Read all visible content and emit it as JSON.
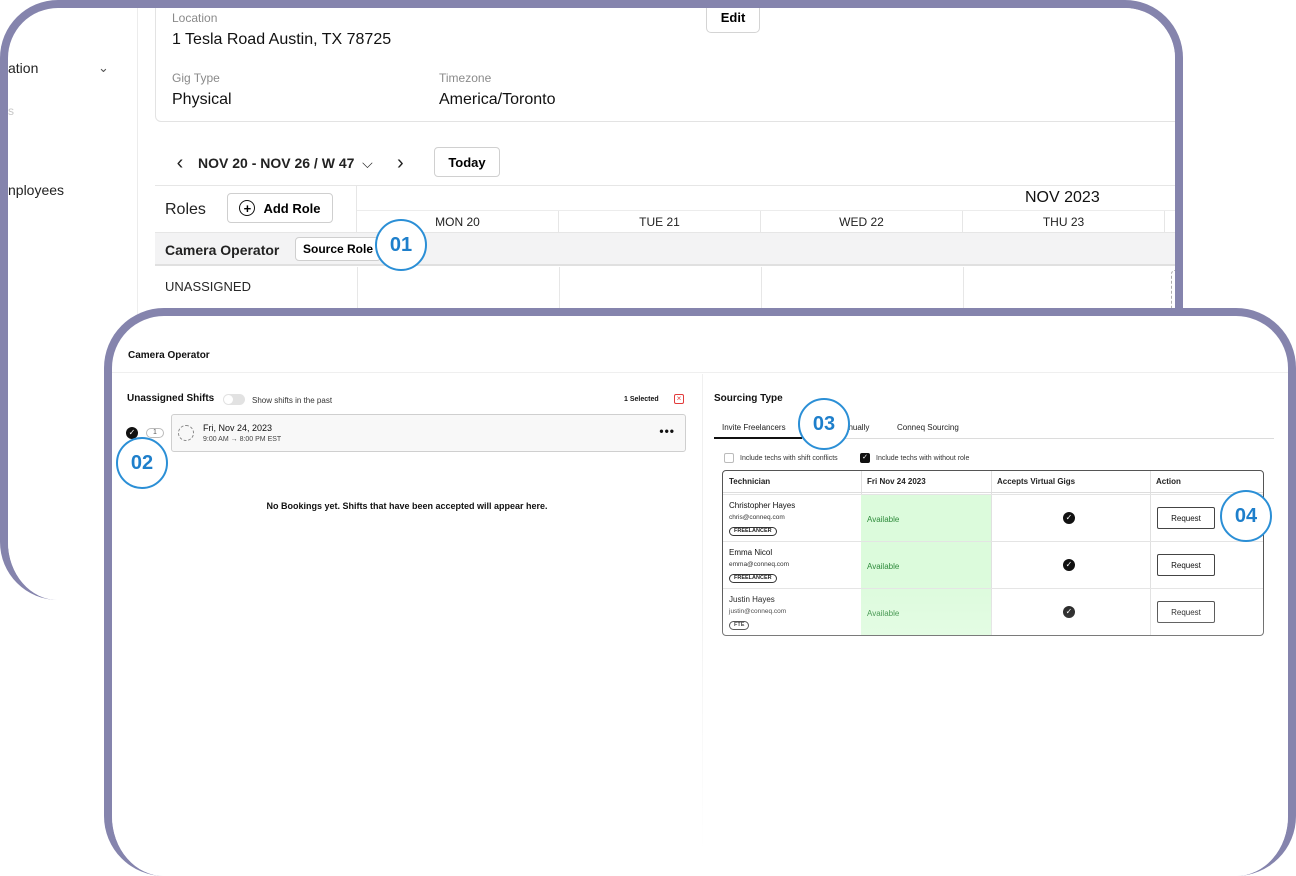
{
  "sidebar": {
    "items": [
      {
        "label": "ation"
      },
      {
        "label": "s"
      },
      {
        "label": "nployees"
      }
    ]
  },
  "gig_info": {
    "location_label": "Location",
    "location_value": "1 Tesla Road Austin, TX 78725",
    "gig_type_label": "Gig Type",
    "gig_type_value": "Physical",
    "timezone_label": "Timezone",
    "timezone_value": "America/Toronto",
    "edit_label": "Edit"
  },
  "week_nav": {
    "range_label": "NOV 20 - NOV 26 / W 47",
    "today_label": "Today"
  },
  "schedule": {
    "roles_label": "Roles",
    "add_role_label": "Add Role",
    "month_label": "NOV 2023",
    "days": [
      "MON 20",
      "TUE 21",
      "WED 22",
      "THU 23"
    ],
    "role_name": "Camera Operator",
    "source_role_label": "Source Role",
    "unassigned_label": "UNASSIGNED"
  },
  "modal": {
    "title": "Camera Operator",
    "unassigned_shifts_label": "Unassigned Shifts",
    "show_past_label": "Show shifts in the past",
    "selected_label": "1 Selected",
    "shift_count": "1",
    "shift": {
      "date": "Fri, Nov 24, 2023",
      "time": "9:00 AM → 8:00 PM EST",
      "menu": "•••"
    },
    "no_bookings": "No Bookings yet. Shifts that have been accepted will appear here.",
    "sourcing_type_label": "Sourcing Type",
    "tabs": [
      {
        "label": "Invite Freelancers",
        "active": true
      },
      {
        "label": "anually",
        "active": false
      },
      {
        "label": "Conneq Sourcing",
        "active": false
      }
    ],
    "filters": [
      {
        "label": "Include techs with shift conflicts",
        "checked": false
      },
      {
        "label": "Include techs with without role",
        "checked": true
      }
    ],
    "table": {
      "headers": [
        "Technician",
        "Fri Nov 24 2023",
        "Accepts Virtual Gigs",
        "Action"
      ],
      "rows": [
        {
          "name": "Christopher Hayes",
          "email": "chris@conneq.com",
          "badge": "FREELANCER",
          "availability": "Available",
          "accepts_virtual": true,
          "action": "Request"
        },
        {
          "name": "Emma Nicol",
          "email": "emma@conneq.com",
          "badge": "FREELANCER",
          "availability": "Available",
          "accepts_virtual": true,
          "action": "Request"
        },
        {
          "name": "Justin Hayes",
          "email": "justin@conneq.com",
          "badge": "FTE",
          "availability": "Available",
          "accepts_virtual": true,
          "action": "Request"
        }
      ]
    }
  },
  "callouts": [
    "01",
    "02",
    "03",
    "04"
  ],
  "colors": {
    "frame": "#8584ad",
    "callout": "#2b8fd6",
    "available_bg": "#dcfbdc",
    "available_text": "#2e8b3b",
    "danger": "#e23b3b"
  }
}
